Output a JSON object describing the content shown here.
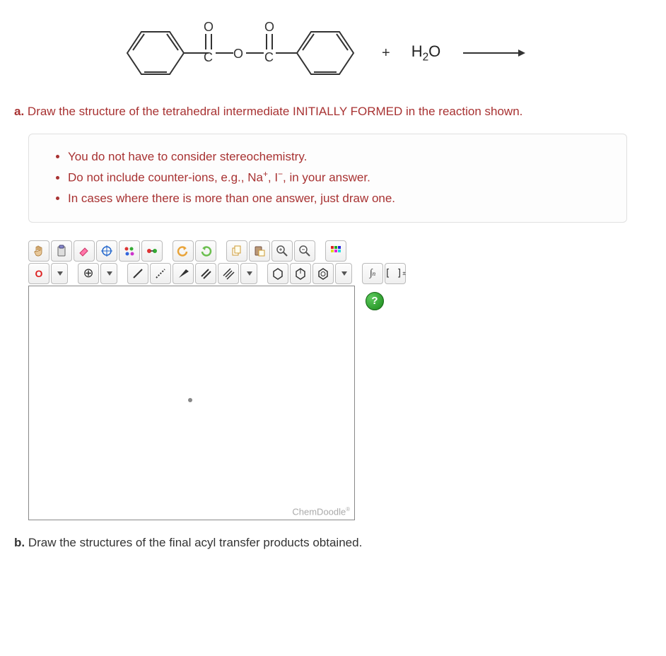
{
  "reaction": {
    "plus": "+",
    "reagent": "H₂O"
  },
  "question_a_prefix": "a.",
  "question_a_text": " Draw the structure of the tetrahedral intermediate INITIALLY FORMED in the reaction shown.",
  "hints": {
    "items": [
      "You do not have to consider stereochemistry.",
      "Do not include counter-ions, e.g., Na⁺, I⁻, in your answer.",
      "In cases where there is more than one answer, just draw one."
    ]
  },
  "toolbar": {
    "row1": {
      "hand": "hand-icon",
      "clipboard": "clipboard-icon",
      "eraser": "eraser-icon",
      "target": "crosshair-icon",
      "atoms": "atoms-icon",
      "group": "group-icon",
      "undo": "undo-icon",
      "redo": "redo-icon",
      "copy": "copy-icon",
      "paste": "paste-icon",
      "zoomin": "zoom-in-icon",
      "zoomout": "zoom-out-icon",
      "color": "color-swatch-icon"
    },
    "row2": {
      "atom_label": "O",
      "charge_label": "⊕",
      "bond1": "single-bond-icon",
      "bond_dotted": "dotted-bond-icon",
      "wedge": "wedge-bond-icon",
      "bond2": "double-bond-icon",
      "bond3": "triple-bond-icon",
      "ring1": "ring-icon",
      "ring2": "ring-stereo-icon",
      "ring3": "benzene-icon",
      "integral": "integral-icon",
      "brackets": "brackets-icon"
    }
  },
  "canvas": {
    "help": "?",
    "brand": "ChemDoodle",
    "brand_mark": "®"
  },
  "question_b_prefix": "b.",
  "question_b_text": " Draw the structures of the final acyl transfer products obtained."
}
